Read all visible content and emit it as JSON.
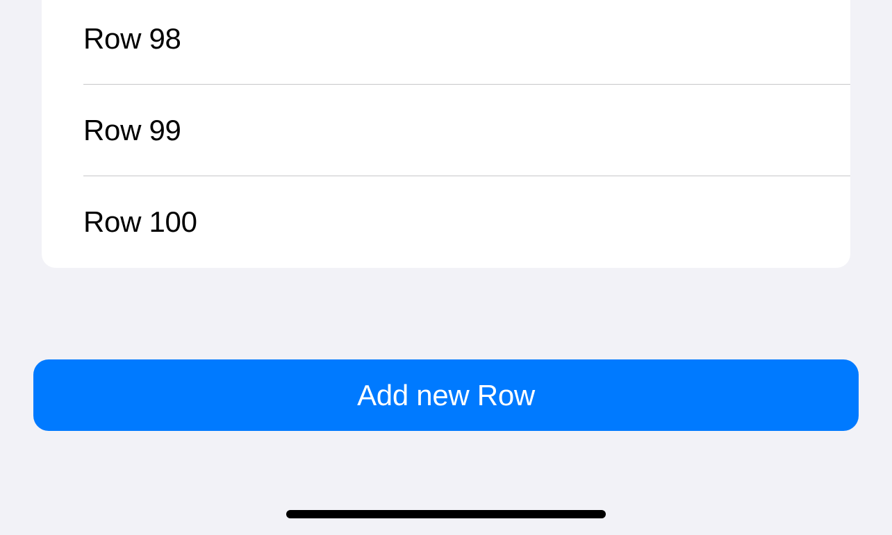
{
  "list": {
    "rows": [
      {
        "label": "Row 98"
      },
      {
        "label": "Row 99"
      },
      {
        "label": "Row 100"
      }
    ]
  },
  "buttons": {
    "add_row_label": "Add new Row"
  }
}
